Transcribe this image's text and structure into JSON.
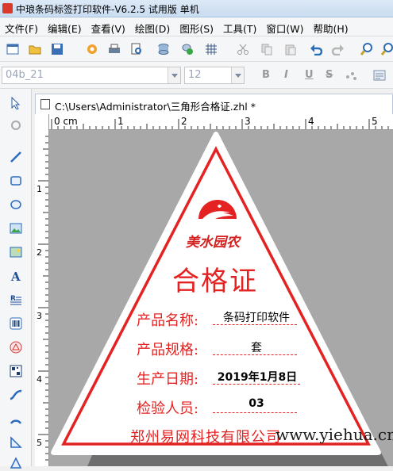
{
  "window": {
    "title": "中琅条码标签打印软件-V6.2.5 试用版 单机"
  },
  "menu": [
    "文件(F)",
    "编辑(E)",
    "查看(V)",
    "绘图(D)",
    "图形(S)",
    "工具(T)",
    "窗口(W)",
    "帮助(H)"
  ],
  "toolbar": {
    "icons": [
      "new-icon",
      "open-icon",
      "save-icon",
      "settings-icon",
      "print-icon",
      "print-preview-icon",
      "database-icon",
      "data-source-icon",
      "grid-icon",
      "cut-icon",
      "copy-icon",
      "paste-icon",
      "undo-icon",
      "redo-icon",
      "zoom-in-icon",
      "zoom-out-icon"
    ]
  },
  "font_bar": {
    "font_name": "04b_21",
    "font_size": "12",
    "bold": "B",
    "italic": "I",
    "underline": "U",
    "strike": "S"
  },
  "document": {
    "tab_title": "C:\\Users\\Administrator\\三角形合格证.zhl *"
  },
  "ruler": {
    "h_labels": [
      "0 cm",
      "1",
      "2",
      "3",
      "4",
      "5"
    ],
    "v_labels": [
      "1",
      "2",
      "3",
      "4",
      "5"
    ]
  },
  "label": {
    "logo_text": "美水园农",
    "heading": "合格证",
    "fields": [
      {
        "name": "产品名称:",
        "value": "条码打印软件"
      },
      {
        "name": "产品规格:",
        "value": "套"
      },
      {
        "name": "生产日期:",
        "value": "2019年1月8日"
      },
      {
        "name": "检验人员:",
        "value": "03"
      }
    ],
    "company": "郑州易网科技有限公司",
    "border_color": "#e52222"
  },
  "watermark": "www.yiehua.cn"
}
